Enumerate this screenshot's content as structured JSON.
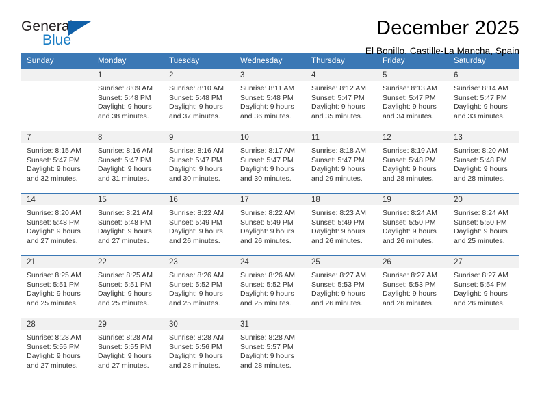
{
  "brand": {
    "line1": "General",
    "line2": "Blue",
    "triangle_color": "#1160a8",
    "blue_text_color": "#1a7dc4"
  },
  "header": {
    "title": "December 2025",
    "subtitle": "El Bonillo, Castille-La Mancha, Spain"
  },
  "theme": {
    "header_blue": "#3b78b5",
    "daynum_band": "#f1f1f1",
    "text": "#333333"
  },
  "calendar": {
    "weekday_headers": [
      "Sunday",
      "Monday",
      "Tuesday",
      "Wednesday",
      "Thursday",
      "Friday",
      "Saturday"
    ],
    "weeks": [
      [
        {
          "day": "",
          "lines": []
        },
        {
          "day": "1",
          "lines": [
            "Sunrise: 8:09 AM",
            "Sunset: 5:48 PM",
            "Daylight: 9 hours",
            "and 38 minutes."
          ]
        },
        {
          "day": "2",
          "lines": [
            "Sunrise: 8:10 AM",
            "Sunset: 5:48 PM",
            "Daylight: 9 hours",
            "and 37 minutes."
          ]
        },
        {
          "day": "3",
          "lines": [
            "Sunrise: 8:11 AM",
            "Sunset: 5:48 PM",
            "Daylight: 9 hours",
            "and 36 minutes."
          ]
        },
        {
          "day": "4",
          "lines": [
            "Sunrise: 8:12 AM",
            "Sunset: 5:47 PM",
            "Daylight: 9 hours",
            "and 35 minutes."
          ]
        },
        {
          "day": "5",
          "lines": [
            "Sunrise: 8:13 AM",
            "Sunset: 5:47 PM",
            "Daylight: 9 hours",
            "and 34 minutes."
          ]
        },
        {
          "day": "6",
          "lines": [
            "Sunrise: 8:14 AM",
            "Sunset: 5:47 PM",
            "Daylight: 9 hours",
            "and 33 minutes."
          ]
        }
      ],
      [
        {
          "day": "7",
          "lines": [
            "Sunrise: 8:15 AM",
            "Sunset: 5:47 PM",
            "Daylight: 9 hours",
            "and 32 minutes."
          ]
        },
        {
          "day": "8",
          "lines": [
            "Sunrise: 8:16 AM",
            "Sunset: 5:47 PM",
            "Daylight: 9 hours",
            "and 31 minutes."
          ]
        },
        {
          "day": "9",
          "lines": [
            "Sunrise: 8:16 AM",
            "Sunset: 5:47 PM",
            "Daylight: 9 hours",
            "and 30 minutes."
          ]
        },
        {
          "day": "10",
          "lines": [
            "Sunrise: 8:17 AM",
            "Sunset: 5:47 PM",
            "Daylight: 9 hours",
            "and 30 minutes."
          ]
        },
        {
          "day": "11",
          "lines": [
            "Sunrise: 8:18 AM",
            "Sunset: 5:47 PM",
            "Daylight: 9 hours",
            "and 29 minutes."
          ]
        },
        {
          "day": "12",
          "lines": [
            "Sunrise: 8:19 AM",
            "Sunset: 5:48 PM",
            "Daylight: 9 hours",
            "and 28 minutes."
          ]
        },
        {
          "day": "13",
          "lines": [
            "Sunrise: 8:20 AM",
            "Sunset: 5:48 PM",
            "Daylight: 9 hours",
            "and 28 minutes."
          ]
        }
      ],
      [
        {
          "day": "14",
          "lines": [
            "Sunrise: 8:20 AM",
            "Sunset: 5:48 PM",
            "Daylight: 9 hours",
            "and 27 minutes."
          ]
        },
        {
          "day": "15",
          "lines": [
            "Sunrise: 8:21 AM",
            "Sunset: 5:48 PM",
            "Daylight: 9 hours",
            "and 27 minutes."
          ]
        },
        {
          "day": "16",
          "lines": [
            "Sunrise: 8:22 AM",
            "Sunset: 5:49 PM",
            "Daylight: 9 hours",
            "and 26 minutes."
          ]
        },
        {
          "day": "17",
          "lines": [
            "Sunrise: 8:22 AM",
            "Sunset: 5:49 PM",
            "Daylight: 9 hours",
            "and 26 minutes."
          ]
        },
        {
          "day": "18",
          "lines": [
            "Sunrise: 8:23 AM",
            "Sunset: 5:49 PM",
            "Daylight: 9 hours",
            "and 26 minutes."
          ]
        },
        {
          "day": "19",
          "lines": [
            "Sunrise: 8:24 AM",
            "Sunset: 5:50 PM",
            "Daylight: 9 hours",
            "and 26 minutes."
          ]
        },
        {
          "day": "20",
          "lines": [
            "Sunrise: 8:24 AM",
            "Sunset: 5:50 PM",
            "Daylight: 9 hours",
            "and 25 minutes."
          ]
        }
      ],
      [
        {
          "day": "21",
          "lines": [
            "Sunrise: 8:25 AM",
            "Sunset: 5:51 PM",
            "Daylight: 9 hours",
            "and 25 minutes."
          ]
        },
        {
          "day": "22",
          "lines": [
            "Sunrise: 8:25 AM",
            "Sunset: 5:51 PM",
            "Daylight: 9 hours",
            "and 25 minutes."
          ]
        },
        {
          "day": "23",
          "lines": [
            "Sunrise: 8:26 AM",
            "Sunset: 5:52 PM",
            "Daylight: 9 hours",
            "and 25 minutes."
          ]
        },
        {
          "day": "24",
          "lines": [
            "Sunrise: 8:26 AM",
            "Sunset: 5:52 PM",
            "Daylight: 9 hours",
            "and 25 minutes."
          ]
        },
        {
          "day": "25",
          "lines": [
            "Sunrise: 8:27 AM",
            "Sunset: 5:53 PM",
            "Daylight: 9 hours",
            "and 26 minutes."
          ]
        },
        {
          "day": "26",
          "lines": [
            "Sunrise: 8:27 AM",
            "Sunset: 5:53 PM",
            "Daylight: 9 hours",
            "and 26 minutes."
          ]
        },
        {
          "day": "27",
          "lines": [
            "Sunrise: 8:27 AM",
            "Sunset: 5:54 PM",
            "Daylight: 9 hours",
            "and 26 minutes."
          ]
        }
      ],
      [
        {
          "day": "28",
          "lines": [
            "Sunrise: 8:28 AM",
            "Sunset: 5:55 PM",
            "Daylight: 9 hours",
            "and 27 minutes."
          ]
        },
        {
          "day": "29",
          "lines": [
            "Sunrise: 8:28 AM",
            "Sunset: 5:55 PM",
            "Daylight: 9 hours",
            "and 27 minutes."
          ]
        },
        {
          "day": "30",
          "lines": [
            "Sunrise: 8:28 AM",
            "Sunset: 5:56 PM",
            "Daylight: 9 hours",
            "and 28 minutes."
          ]
        },
        {
          "day": "31",
          "lines": [
            "Sunrise: 8:28 AM",
            "Sunset: 5:57 PM",
            "Daylight: 9 hours",
            "and 28 minutes."
          ]
        },
        {
          "day": "",
          "lines": []
        },
        {
          "day": "",
          "lines": []
        },
        {
          "day": "",
          "lines": []
        }
      ]
    ]
  }
}
